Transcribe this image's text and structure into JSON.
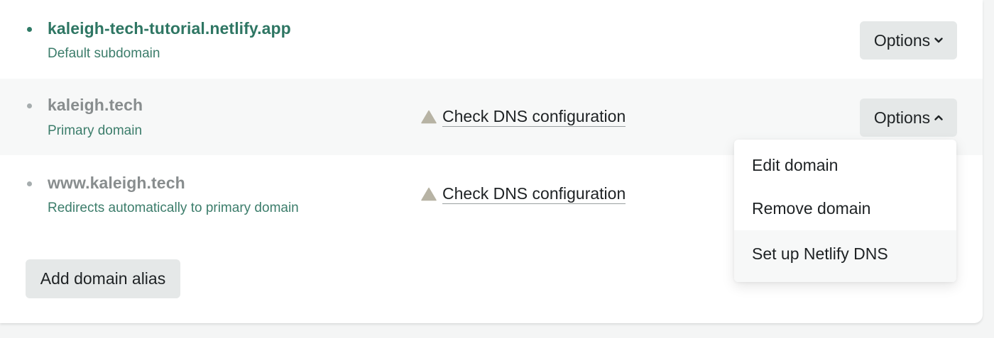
{
  "domains": [
    {
      "name": "kaleigh-tech-tutorial.netlify.app",
      "description": "Default subdomain",
      "options_label": "Options"
    },
    {
      "name": "kaleigh.tech",
      "description": "Primary domain",
      "dns_link": "Check DNS configuration",
      "options_label": "Options"
    },
    {
      "name": "www.kaleigh.tech",
      "description": "Redirects automatically to primary domain",
      "dns_link": "Check DNS configuration"
    }
  ],
  "add_alias_label": "Add domain alias",
  "options_menu": {
    "items": [
      {
        "label": "Edit domain"
      },
      {
        "label": "Remove domain"
      },
      {
        "label": "Set up Netlify DNS"
      }
    ]
  },
  "icons": {
    "warning": "warning-triangle-icon",
    "chevron_down": "chevron-down-icon",
    "chevron_up": "chevron-up-icon"
  },
  "colors": {
    "accent_green": "#2e7663",
    "description_green": "#3c7d6b",
    "muted_domain": "#888d8e",
    "button_bg": "#e5e8e8",
    "warning_icon": "#b7b3a4"
  }
}
